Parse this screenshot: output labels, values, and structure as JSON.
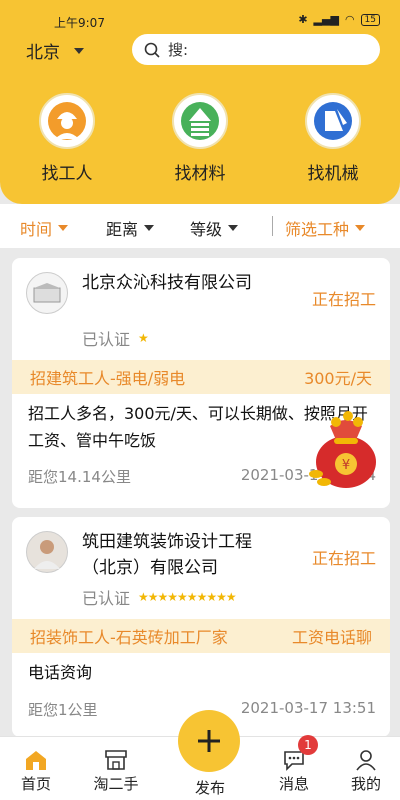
{
  "status_bar": {
    "time": "上午9:07",
    "battery": "15"
  },
  "header": {
    "city": "北京",
    "search_placeholder": "搜:",
    "categories": [
      {
        "label": "找工人",
        "icon": "worker-icon"
      },
      {
        "label": "找材料",
        "icon": "material-icon"
      },
      {
        "label": "找机械",
        "icon": "excavator-icon"
      }
    ]
  },
  "filters": [
    {
      "label": "时间",
      "active": true
    },
    {
      "label": "距离",
      "active": false
    },
    {
      "label": "等级",
      "active": false
    },
    {
      "label": "筛选工种",
      "active": true
    }
  ],
  "listings": [
    {
      "company": "北京众沁科技有限公司",
      "status": "正在招工",
      "verified": "已认证",
      "rating_stars": 1,
      "job_title": "招建筑工人-强电/弱电",
      "pay": "300元/天",
      "description": "招工人多名，300元/天、可以长期做、按照月开工资、管中午吃饭",
      "distance": "距您14.14公里",
      "date": "2021-03-17 18:54"
    },
    {
      "company": "筑田建筑装饰设计工程（北京）有限公司",
      "status": "正在招工",
      "verified": "已认证",
      "rating_stars": 10,
      "job_title": "招装饰工人-石英砖加工厂家",
      "pay": "工资电话聊",
      "description": "电话资询",
      "distance": "距您1公里",
      "date": "2021-03-17 13:51"
    }
  ],
  "tabbar": {
    "tabs": [
      {
        "label": "首页",
        "icon": "home-icon",
        "active": true
      },
      {
        "label": "淘二手",
        "icon": "shop-icon"
      },
      {
        "label": "发布",
        "icon": "plus-icon"
      },
      {
        "label": "消息",
        "icon": "message-icon",
        "badge": "1"
      },
      {
        "label": "我的",
        "icon": "profile-icon"
      }
    ]
  },
  "colors": {
    "brand": "#f7c433",
    "accent": "#e8892a",
    "badge": "#e23b3b"
  }
}
